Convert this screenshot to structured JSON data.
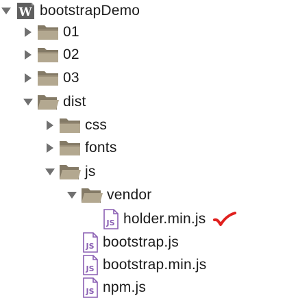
{
  "tree": {
    "project": {
      "label": "bootstrapDemo",
      "expanded": true,
      "icon": "project-w-icon"
    },
    "folder_01": {
      "label": "01",
      "expanded": false,
      "icon": "folder-icon"
    },
    "folder_02": {
      "label": "02",
      "expanded": false,
      "icon": "folder-icon"
    },
    "folder_03": {
      "label": "03",
      "expanded": false,
      "icon": "folder-icon"
    },
    "folder_dist": {
      "label": "dist",
      "expanded": true,
      "icon": "folder-open-icon"
    },
    "folder_css": {
      "label": "css",
      "expanded": false,
      "icon": "folder-icon"
    },
    "folder_fonts": {
      "label": "fonts",
      "expanded": false,
      "icon": "folder-icon"
    },
    "folder_js": {
      "label": "js",
      "expanded": true,
      "icon": "folder-open-icon"
    },
    "folder_vendor": {
      "label": "vendor",
      "expanded": true,
      "icon": "folder-open-icon"
    },
    "file_holder": {
      "label": "holder.min.js",
      "icon": "js-file-icon",
      "marked": true,
      "mark_icon": "red-checkmark-icon"
    },
    "file_bootstrap": {
      "label": "bootstrap.js",
      "icon": "js-file-icon"
    },
    "file_bootstrap_min": {
      "label": "bootstrap.min.js",
      "icon": "js-file-icon"
    },
    "file_npm": {
      "label": "npm.js",
      "icon": "js-file-icon"
    }
  },
  "colors": {
    "arrow": "#707070",
    "folder_body": "#9a8e78",
    "folder_tab": "#847a66",
    "folder_front": "#b3a890",
    "js_icon": "#8a5fb3",
    "project_icon_bg": "#5f5f5f",
    "check": "#e0201e"
  }
}
